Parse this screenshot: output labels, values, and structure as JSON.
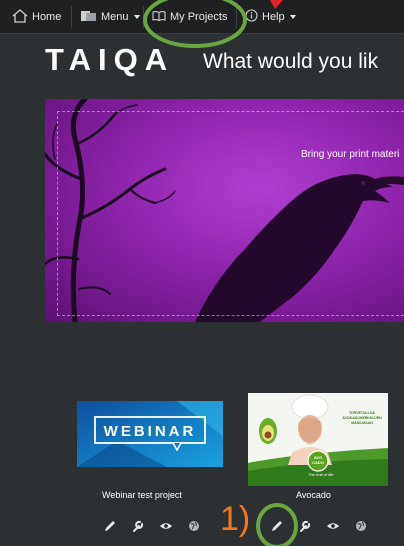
{
  "nav": {
    "home": "Home",
    "menu": "Menu",
    "my_projects": "My Projects",
    "help": "Help"
  },
  "heading": {
    "logo": "TAIQA",
    "tagline": "What would you lik"
  },
  "banner": {
    "text": "Bring your print materi"
  },
  "projects": [
    {
      "title": "Webinar test project",
      "thumb_text": "WEBINAR"
    },
    {
      "title": "Avocado",
      "thumb_lines": [
        "TORVETULLOA",
        "AVOKADOHERKKUJEN",
        "MAAILMAAN"
      ],
      "badge_top": "AVO",
      "badge_bottom": "CADO",
      "slogan": "The fruit of life"
    }
  ],
  "annotation": {
    "step_label": "1)"
  },
  "colors": {
    "nav_bg": "#1e2022",
    "page_bg": "#2d3033",
    "banner_purple": "#a030c0",
    "annotation_green": "#6aa544",
    "annotation_orange": "#f07a1a",
    "annotation_red": "#e0222a"
  }
}
